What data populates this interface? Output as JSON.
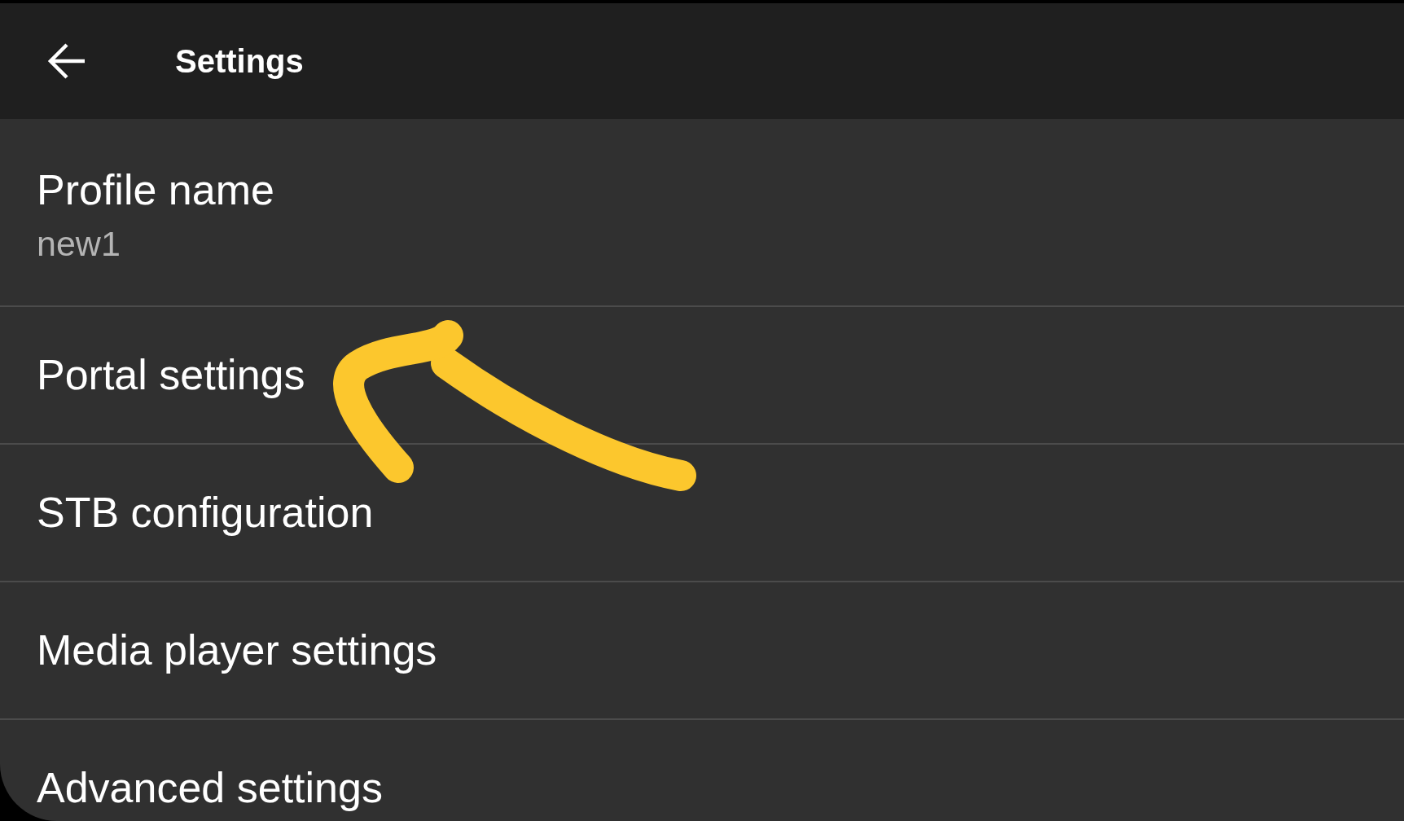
{
  "toolbar": {
    "title": "Settings"
  },
  "settings": [
    {
      "title": "Profile name",
      "summary": "new1"
    },
    {
      "title": "Portal settings"
    },
    {
      "title": "STB configuration"
    },
    {
      "title": "Media player settings"
    },
    {
      "title": "Advanced settings"
    }
  ]
}
